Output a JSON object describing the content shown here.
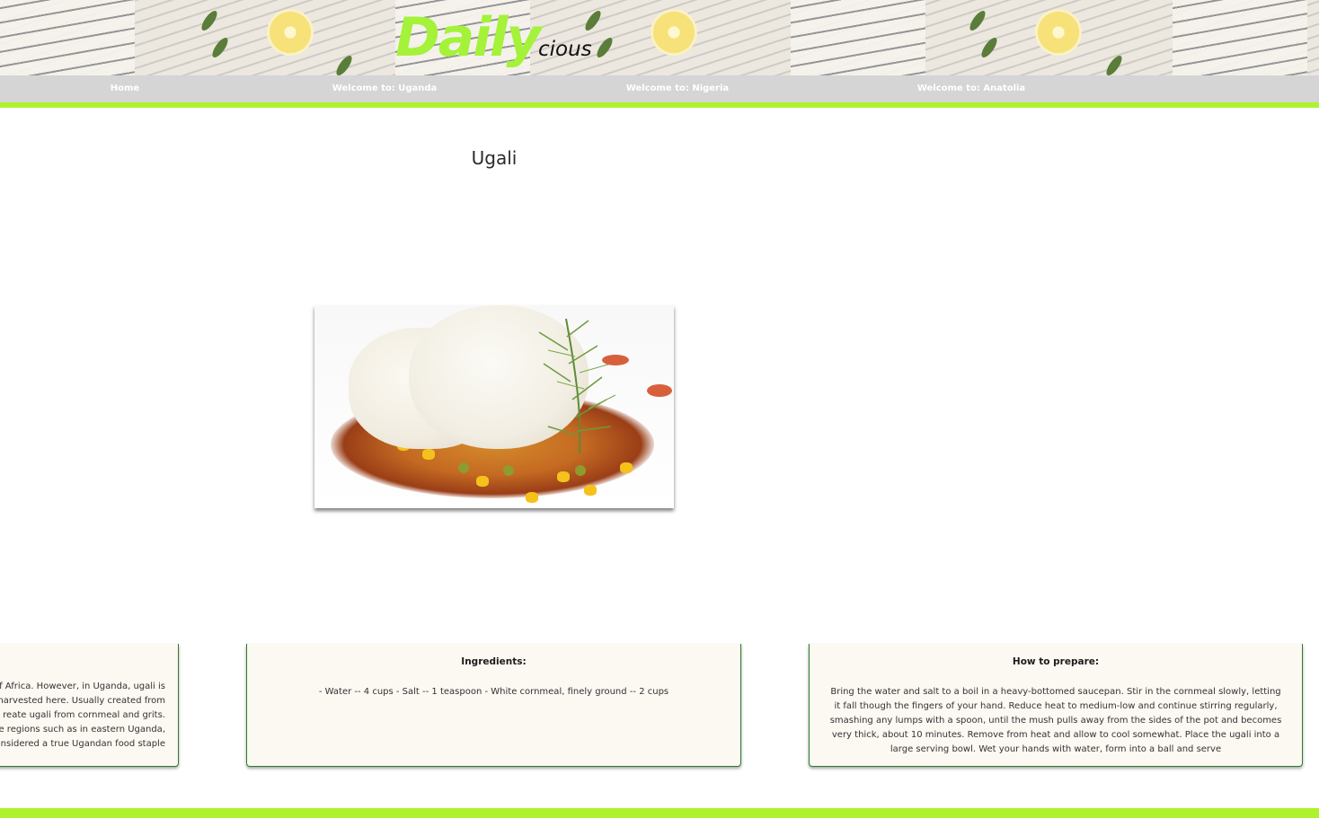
{
  "brand": {
    "logo_main": "Daily",
    "logo_suffix": "cious",
    "accent_color": "#aef22f"
  },
  "nav": {
    "items": [
      {
        "label": "Home"
      },
      {
        "label": "Welcome to: Uganda"
      },
      {
        "label": "Welcome to: Nigeria"
      },
      {
        "label": "Welcome to: Anatolia"
      }
    ]
  },
  "main": {
    "title": "Ugali",
    "image_icon": "ugali-dish-photo"
  },
  "cards": {
    "intro": {
      "lines": [
        "of Africa. However, in Uganda, ugali is",
        "e harvested here. Usually created from",
        "reate ugali from cornmeal and grits.",
        "ome regions such as in eastern Uganda,",
        "nsidered a true Ugandan food staple"
      ]
    },
    "ingredients": {
      "title": "Ingredients:",
      "body": "- Water -- 4 cups - Salt -- 1 teaspoon - White cornmeal, finely ground -- 2 cups"
    },
    "preparation": {
      "title": "How to prepare:",
      "body": "Bring the water and salt to a boil in a heavy-bottomed saucepan. Stir in the cornmeal slowly, letting it fall though the fingers of your hand. Reduce heat to medium-low and continue stirring regularly, smashing any lumps with a spoon, until the mush pulls away from the sides of the pot and becomes very thick, about 10 minutes. Remove from heat and allow to cool somewhat. Place the ugali into a large serving bowl. Wet your hands with water, form into a ball and serve"
    }
  }
}
